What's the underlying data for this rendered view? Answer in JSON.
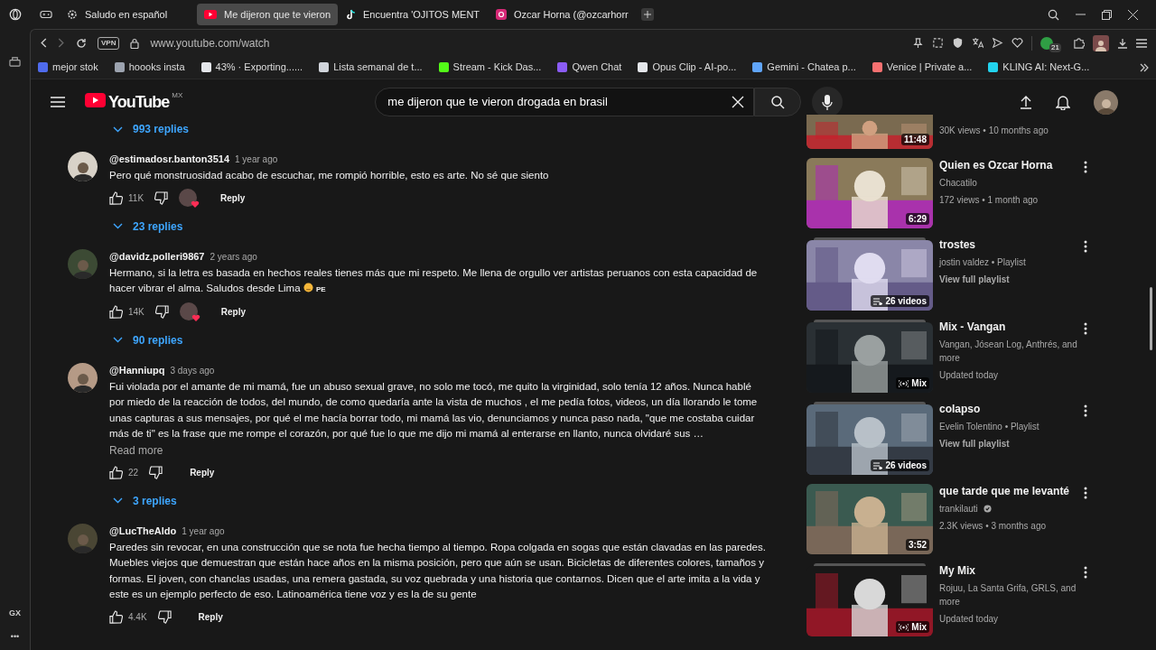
{
  "browser": {
    "tabs": [
      {
        "title": "Saludo en español",
        "selected": false
      },
      {
        "title": "Me dijeron que te vieron",
        "selected": true
      },
      {
        "title": "Encuentra 'OJITOS MENT",
        "selected": false
      },
      {
        "title": "Ozcar Horna (@ozcarhorr",
        "selected": false
      }
    ],
    "vpn": "VPN",
    "address": "www.youtube.com/watch",
    "extension_badge": "21",
    "bookmarks": [
      {
        "label": "mejor stok",
        "color": "#4f6bed"
      },
      {
        "label": "hoooks insta",
        "color": "#9ca3af"
      },
      {
        "label": "43% · Exporting......",
        "color": "#e5e7eb"
      },
      {
        "label": "Lista semanal de t...",
        "color": "#d1d5db"
      },
      {
        "label": "Stream - Kick Das...",
        "color": "#53fc18"
      },
      {
        "label": "Qwen Chat",
        "color": "#8b5cf6"
      },
      {
        "label": "Opus Clip - AI-po...",
        "color": "#e5e7eb"
      },
      {
        "label": "Gemini - Chatea p...",
        "color": "#60a5fa"
      },
      {
        "label": "Venice | Private a...",
        "color": "#f87171"
      },
      {
        "label": "KLING AI: Next-G...",
        "color": "#22d3ee"
      }
    ],
    "side_label": "GX",
    "side_more": "•••"
  },
  "youtube": {
    "logo_text": "YouTube",
    "logo_region": "MX",
    "search": "me dijeron que te vieron drogada en brasil",
    "leading_replies": "993 replies",
    "comments": [
      {
        "author": "@estimadosr.banton3514",
        "time": "1 year ago",
        "text": "Pero qué monstruosidad acabo de escuchar, me rompió horrible, esto es arte. No sé que siento",
        "likes": "11K",
        "creator_heart": true,
        "reply": "Reply",
        "replies": "23 replies"
      },
      {
        "author": "@davidz.polleri9867",
        "time": "2 years ago",
        "text": "Hermano, si la letra es basada en hechos reales tienes más que mi respeto. Me llena de orgullo ver artistas peruanos con esta capacidad de hacer vibrar el alma. Saludos desde Lima",
        "emoji": true,
        "flag": "PE",
        "likes": "14K",
        "creator_heart": true,
        "reply": "Reply",
        "replies": "90 replies"
      },
      {
        "author": "@Hanniupq",
        "time": "3 days ago",
        "text": "Fui violada por el amante de mi mamá, fue un abuso sexual grave, no solo me tocó, me quito la virginidad, solo tenía 12 años. Nunca hablé por miedo de la reacción de todos, del mundo, de como quedaría ante la vista de muchos , el me pedía fotos, videos, un día llorando le tome unas capturas a sus mensajes, por qué el me hacía borrar todo, mi mamá las vio, denunciamos y nunca paso nada, \"que me costaba cuidar más de ti\" es la frase que me rompe el corazón, por qué fue lo que me dijo mi mamá al enterarse en llanto, nunca olvidaré sus …",
        "read_more": "Read more",
        "likes": "22",
        "creator_heart": false,
        "reply": "Reply",
        "replies": "3 replies"
      },
      {
        "author": "@LucTheAldo",
        "time": "1 year ago",
        "text": "Paredes sin revocar, en una construcción que se nota fue hecha tiempo al tiempo. Ropa colgada en sogas que están clavadas en las paredes. Muebles viejos que  demuestran que están hace años en la misma posición, pero que aún se usan. Bicicletas de diferentes colores, tamaños y formas. El joven, con chanclas usadas, una remera gastada, su voz quebrada y una historia que contarnos. Dicen que el arte imita a la vida y este es un ejemplo perfecto de eso. Latinoamérica tiene voz y es la de su gente",
        "likes": "4.4K",
        "creator_heart": false,
        "reply": "Reply"
      }
    ],
    "related": [
      {
        "kind": "partial",
        "meta": "30K views • 10 months ago",
        "badge": "11:48"
      },
      {
        "kind": "video",
        "title": "Quien es Ozcar Horna",
        "channel": "Chacatilo",
        "meta": "172 views • 1 month ago",
        "badge": "6:29"
      },
      {
        "kind": "playlist",
        "title": "trostes",
        "channel": "jostin valdez • Playlist",
        "meta": "View full playlist",
        "badge": "26 videos"
      },
      {
        "kind": "mix",
        "title": "Mix - Vangan",
        "channel": "Vangan, Jósean Log, Anthrés, and more",
        "meta": "Updated today",
        "badge": "Mix"
      },
      {
        "kind": "playlist",
        "title": "colapso",
        "channel": "Evelin Tolentino • Playlist",
        "meta": "View full playlist",
        "badge": "26 videos"
      },
      {
        "kind": "video",
        "title": "que tarde que me levanté",
        "channel": "trankilauti",
        "verified": true,
        "meta": "2.3K views • 3 months ago",
        "badge": "3:52"
      },
      {
        "kind": "mix",
        "title": "My Mix",
        "channel": "Rojuu, La Santa Grifa, GRLS, and more",
        "meta": "Updated today",
        "badge": "Mix"
      }
    ]
  }
}
